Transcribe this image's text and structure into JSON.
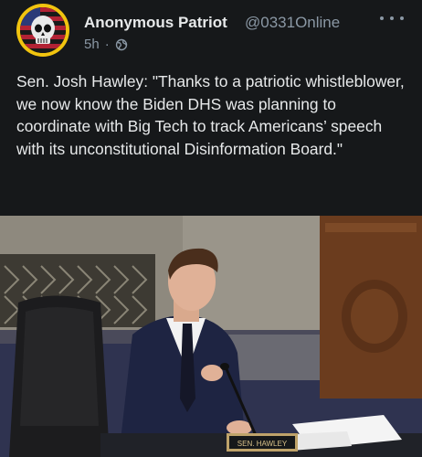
{
  "author": {
    "display_name": "Anonymous Patriot",
    "handle": "@0331Online",
    "avatar_icon": "skull-flag-avatar",
    "timestamp": "5h",
    "separator": "·",
    "visibility_icon": "globe-icon"
  },
  "post": {
    "text": "Sen. Josh Hawley: \"Thanks to a patriotic whistleblower, we now know the Biden DHS was planning to coordinate with Big Tech to track Americans’ speech with its unconstitutional Disinformation Board.\""
  },
  "media": {
    "nameplate": "SEN. HAWLEY"
  },
  "menu": {
    "icon": "more-options-icon"
  },
  "colors": {
    "background": "#16181a",
    "text_primary": "#e7e9ea",
    "text_secondary": "#8b98a5",
    "avatar_ring": "#f1c40f"
  }
}
